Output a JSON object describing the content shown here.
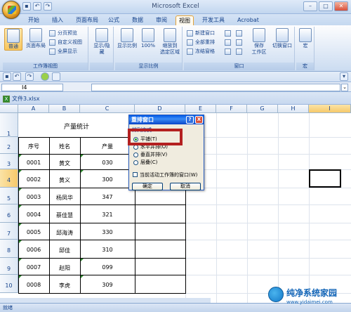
{
  "app": {
    "title": "Microsoft Excel"
  },
  "tabs": [
    "开始",
    "插入",
    "页面布局",
    "公式",
    "数据",
    "审阅",
    "视图",
    "开发工具",
    "Acrobat"
  ],
  "active_tab": "视图",
  "ribbon": {
    "group1": {
      "label": "工作簿视图",
      "normal": "普通",
      "page_layout": "页面布局",
      "page_break": "分页预览",
      "custom_view": "自定义视图",
      "fullscreen": "全屏显示"
    },
    "group2": {
      "label": "",
      "show_hide": "显示/隐藏"
    },
    "group3": {
      "label": "显示比例",
      "zoom": "显示比例",
      "zoom100": "100%",
      "zoom_sel": "缩放到",
      "zoom_sel2": "选定区域"
    },
    "group4": {
      "label": "窗口",
      "new_window": "新建窗口",
      "arrange": "全部重排",
      "freeze": "冻结窗格",
      "save_ws": "保存",
      "save_ws2": "工作区",
      "switch": "切换窗口"
    },
    "group5": {
      "label": "宏",
      "macro": "宏"
    }
  },
  "name_box": "I4",
  "workbook": {
    "title": "文件3.xlsx"
  },
  "columns": [
    "A",
    "B",
    "C",
    "D",
    "E",
    "F",
    "G",
    "H",
    "I"
  ],
  "rows": [
    "1",
    "2",
    "3",
    "4",
    "5",
    "6",
    "7",
    "8",
    "9",
    "10"
  ],
  "sheet": {
    "title": "产量统计",
    "headers": [
      "序号",
      "姓名",
      "产量"
    ],
    "data": [
      [
        "0001",
        "黄文",
        "030"
      ],
      [
        "0002",
        "黄义",
        "300"
      ],
      [
        "0003",
        "杨凤华",
        "347"
      ],
      [
        "0004",
        "蔡佳慧",
        "321"
      ],
      [
        "0005",
        "邱海涛",
        "330"
      ],
      [
        "0006",
        "邱佳",
        "310"
      ],
      [
        "0007",
        "赵阳",
        "099"
      ],
      [
        "0008",
        "李虎",
        "309"
      ]
    ]
  },
  "dialog": {
    "title": "重排窗口",
    "section": "排列方式",
    "options": [
      "平铺(T)",
      "水平并排(O)",
      "垂直并排(V)",
      "层叠(C)"
    ],
    "checkbox": "当前活动工作簿的窗口(W)",
    "ok": "确定",
    "cancel": "取消",
    "help": "?",
    "close": "X"
  },
  "status": "就绪",
  "watermark": {
    "name": "纯净系统家园",
    "url": "www.yidaimei.com"
  }
}
